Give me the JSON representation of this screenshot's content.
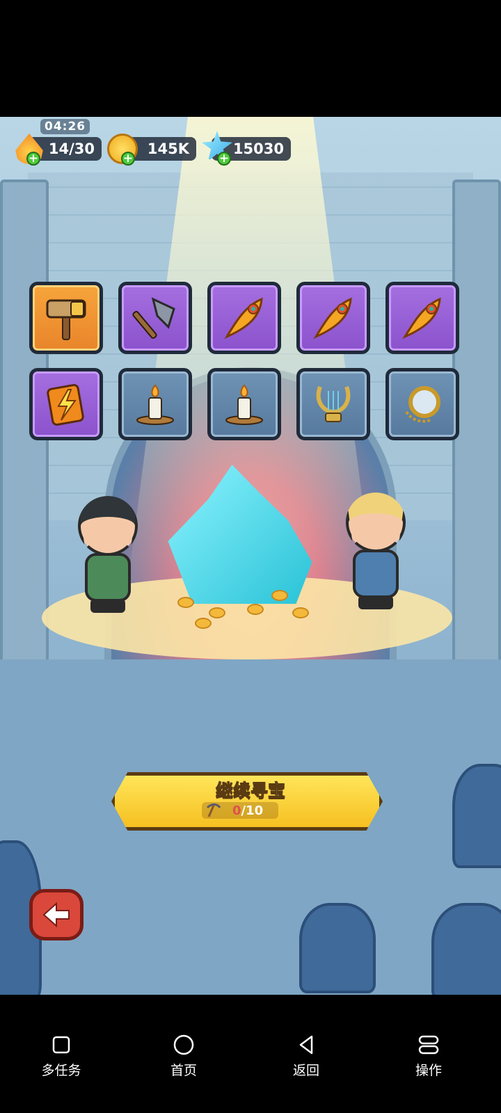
{
  "hud": {
    "timer": "04:26",
    "energy": "14/30",
    "coins": "145K",
    "gems": "15030"
  },
  "inventory": {
    "row1": [
      {
        "icon": "hammer-icon",
        "rarity": "orange"
      },
      {
        "icon": "axe-icon",
        "rarity": "purple"
      },
      {
        "icon": "feather-icon",
        "rarity": "purple"
      },
      {
        "icon": "feather-icon",
        "rarity": "purple"
      },
      {
        "icon": "feather-icon",
        "rarity": "purple"
      }
    ],
    "row2": [
      {
        "icon": "lightning-scroll-icon",
        "rarity": "purple"
      },
      {
        "icon": "candle-icon",
        "rarity": "blue"
      },
      {
        "icon": "candle-icon",
        "rarity": "blue"
      },
      {
        "icon": "lyre-icon",
        "rarity": "blue"
      },
      {
        "icon": "pocket-watch-icon",
        "rarity": "blue"
      }
    ]
  },
  "action": {
    "continue_label": "继续寻宝",
    "progress_current": "0",
    "progress_total": "/10"
  },
  "nav": {
    "multitask": "多任务",
    "home": "首页",
    "back": "返回",
    "operate": "操作"
  },
  "colors": {
    "orange_slot": "#f7a53c",
    "purple_slot": "#a56fe0",
    "blue_slot": "#6f93b5",
    "button_yellow": "#ffe55a"
  }
}
